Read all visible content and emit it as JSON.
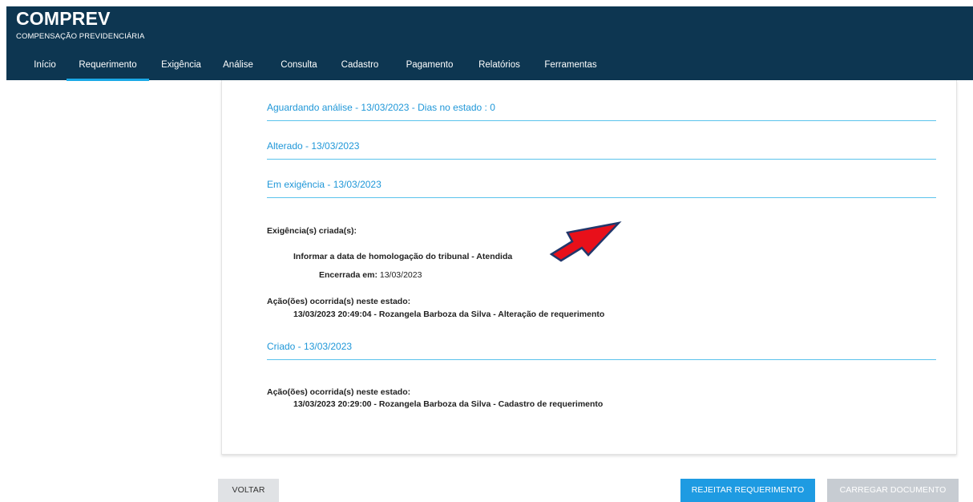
{
  "header": {
    "brand": "COMPREV",
    "subtitle": "COMPENSAÇÃO PREVIDENCIÁRIA",
    "nav": [
      "Início",
      "Requerimento",
      "Exigência",
      "Análise",
      "Consulta",
      "Cadastro",
      "Pagamento",
      "Relatórios",
      "Ferramentas"
    ],
    "active_nav": "Requerimento"
  },
  "history": {
    "aguardando_title": "Aguardando análise - 13/03/2023 - Dias no estado : 0",
    "alterado_title": "Alterado - 13/03/2023",
    "exigencia_title": "Em exigência - 13/03/2023",
    "exigencias_label": "Exigência(s) criada(s):",
    "exigencia_item": "Informar a data de homologação do tribunal - Atendida",
    "encerrada_label": "Encerrada em:",
    "encerrada_date": "13/03/2023",
    "acoes_label_1": "Ação(ões) ocorrida(s) neste estado:",
    "acao_1": "13/03/2023 20:49:04 - Rozangela Barboza da Silva - Alteração de requerimento",
    "criado_title": "Criado - 13/03/2023",
    "acoes_label_2": "Ação(ões) ocorrida(s) neste estado:",
    "acao_2": "13/03/2023 20:29:00 - Rozangela Barboza da Silva - Cadastro de requerimento"
  },
  "buttons": {
    "voltar": "VOLTAR",
    "rejeitar": "REJEITAR REQUERIMENTO",
    "carregar": "CARREGAR DOCUMENTO"
  },
  "colors": {
    "header_bg": "#0d3651",
    "accent": "#1aa9e6",
    "state_text": "#1f97d8",
    "arrow": "#e8101a"
  },
  "icons": {
    "annotation": "red-arrow-icon"
  }
}
